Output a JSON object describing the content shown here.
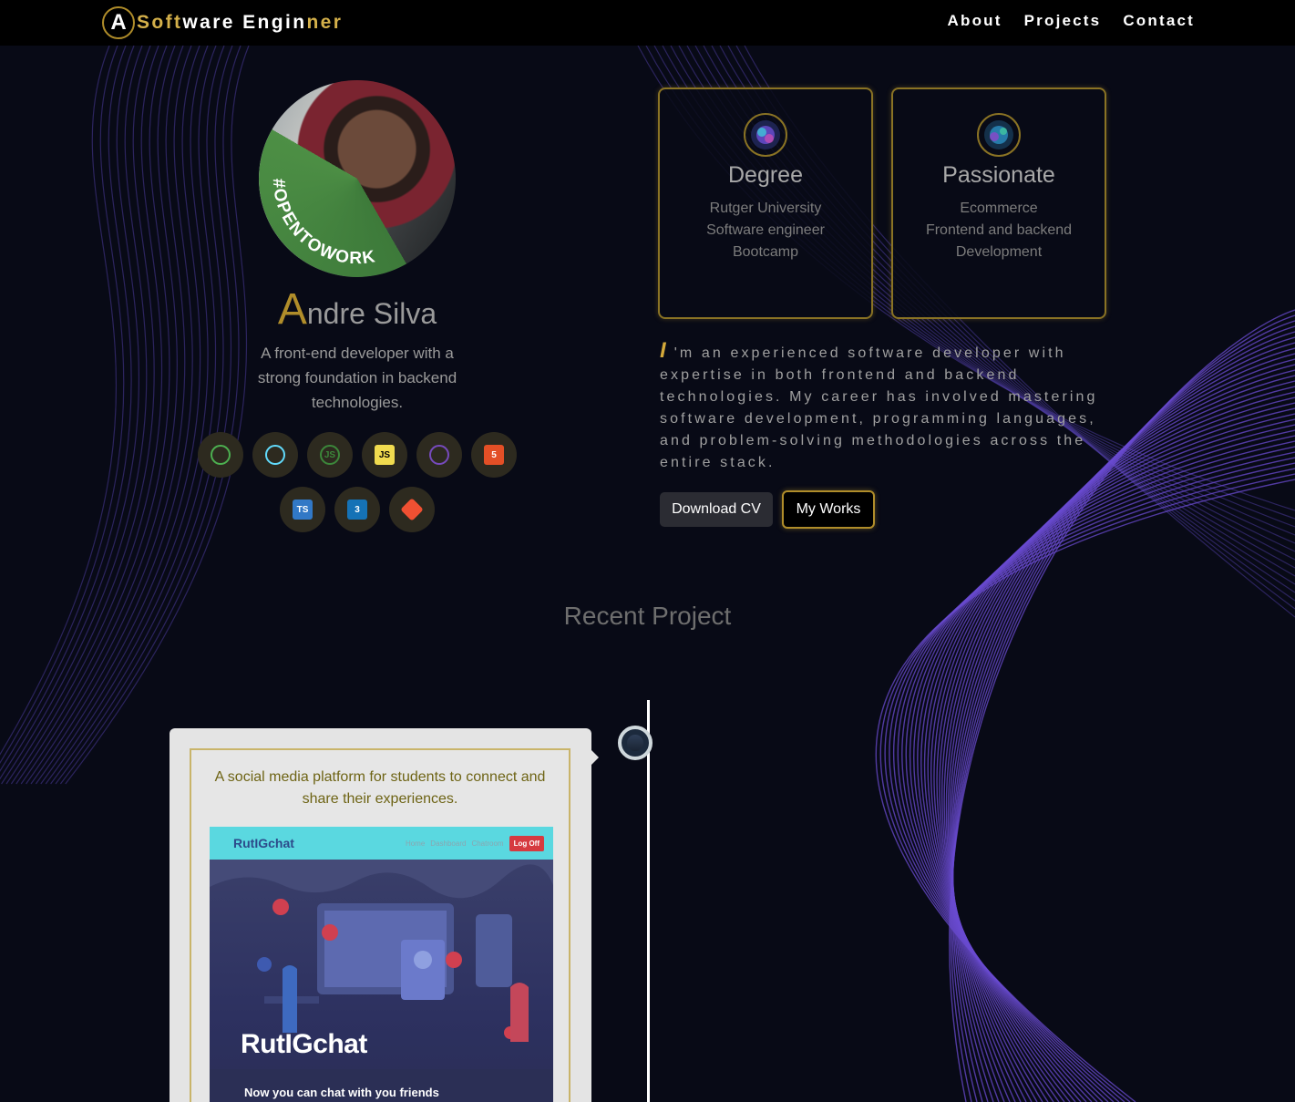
{
  "nav": {
    "logo_letter": "A",
    "logo_parts": [
      "Soft",
      "ware Engin",
      "ner"
    ],
    "links": [
      "About",
      "Projects",
      "Contact"
    ]
  },
  "profile": {
    "badge_text": "#OPENTOWORK",
    "name_initial": "A",
    "name_rest": "ndre Silva",
    "tagline": "A front-end developer with a strong foundation in backend technologies."
  },
  "skills": [
    {
      "icon": "mongodb-icon",
      "label": "",
      "color": "#4caf50"
    },
    {
      "icon": "react-icon",
      "label": "",
      "color": "#61dafb"
    },
    {
      "icon": "nodejs-icon",
      "label": "JS",
      "color": "#3c873a"
    },
    {
      "icon": "javascript-icon",
      "label": "JS",
      "color": "#f0db4f"
    },
    {
      "icon": "redux-icon",
      "label": "",
      "color": "#764abc"
    },
    {
      "icon": "html5-icon",
      "label": "5",
      "color": "#e34f26"
    },
    {
      "icon": "typescript-icon",
      "label": "TS",
      "color": "#3178c6"
    },
    {
      "icon": "css3-icon",
      "label": "3",
      "color": "#1572b6"
    },
    {
      "icon": "git-icon",
      "label": "",
      "color": "#f05032"
    }
  ],
  "cards": [
    {
      "title": "Degree",
      "lines": [
        "Rutger University",
        "Software engineer",
        "Bootcamp"
      ]
    },
    {
      "title": "Passionate",
      "lines": [
        "Ecommerce",
        "Frontend and backend",
        "Development"
      ]
    }
  ],
  "about": {
    "initial": "I",
    "text": "'m an experienced software developer with expertise in both frontend and backend technologies. My career has involved mastering software development, programming languages, and problem-solving methodologies across the entire stack."
  },
  "buttons": {
    "download": "Download CV",
    "works": "My Works"
  },
  "section_title": "Recent Project",
  "project": {
    "description": "A social media platform for students to connect and share their experiences.",
    "screenshot": {
      "brand": "RutIGchat",
      "links": [
        "Home",
        "Dashboard",
        "Chatroom"
      ],
      "logoff": "Log Off",
      "hero_title": "RutIGchat",
      "hero_sub": "Now you can chat with you friends"
    }
  },
  "colors": {
    "background": "#080a16",
    "gold": "#b08d2a",
    "wave": "#5b3fa8"
  }
}
